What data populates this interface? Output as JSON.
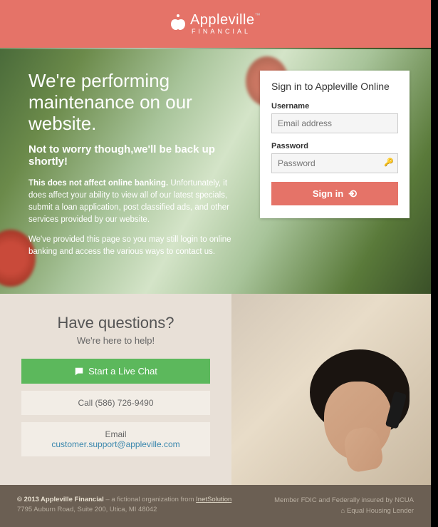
{
  "brand": {
    "name": "Appleville",
    "tm": "™",
    "sub": "FINANCIAL"
  },
  "hero": {
    "title": "We're performing maintenance on our website.",
    "subtitle": "Not to worry though,we'll be back up shortly!",
    "strong": "This does not affect online banking.",
    "p1_rest": " Unfortunately, it does affect your ability to view all of our latest specials, submit a loan application, post classified ads, and other services provided by our website.",
    "p2": "We've provided this page so you may still login to online banking and access the various ways to contact us."
  },
  "signin": {
    "title": "Sign in to Appleville Online",
    "username_label": "Username",
    "username_placeholder": "Email address",
    "password_label": "Password",
    "password_placeholder": "Password",
    "button": "Sign in"
  },
  "help": {
    "title": "Have questions?",
    "sub": "We're here to help!",
    "chat": "Start a Live Chat",
    "call": "Call (586) 726-9490",
    "email_label": "Email",
    "email_address": "customer.support@appleville.com"
  },
  "footer": {
    "copyright": "© 2013 Appleville Financial",
    "desc": " – a fictional organization from ",
    "link": "InetSolution",
    "address": "7795 Auburn Road, Suite 200, Utica, MI 48042",
    "right1": "Member FDIC and Federally insured by NCUA",
    "right2": "⌂ Equal Housing Lender"
  }
}
